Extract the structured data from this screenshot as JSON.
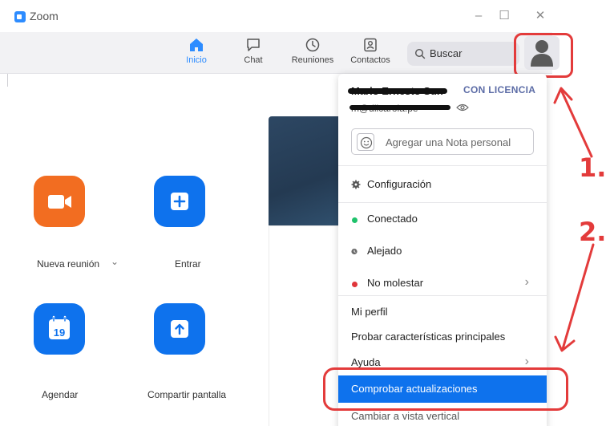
{
  "app": {
    "title": "Zoom"
  },
  "nav": {
    "tabs": [
      {
        "label": "Inicio",
        "icon": "home-icon",
        "active": true
      },
      {
        "label": "Chat",
        "icon": "chat-bubble-icon",
        "active": false
      },
      {
        "label": "Reuniones",
        "icon": "clock-icon",
        "active": false
      },
      {
        "label": "Contactos",
        "icon": "contact-card-icon",
        "active": false
      }
    ],
    "search_label": "Buscar"
  },
  "home": {
    "new_meeting_label": "Nueva reunión",
    "new_meeting_chevron": "⌄",
    "join_label": "Entrar",
    "schedule_label": "Agendar",
    "schedule_day": "19",
    "share_screen_label": "Compartir pantalla"
  },
  "profile_menu": {
    "user_name": "Mario Ernesto Sun",
    "license_badge": "CON LICENCIA",
    "email": "m@dlicarola.pe",
    "note_placeholder": "Agregar una Nota personal",
    "settings_label": "Configuración",
    "status": {
      "connected_label": "Conectado",
      "away_label": "Alejado",
      "dnd_label": "No molestar"
    },
    "profile_label": "Mi perfil",
    "try_features_label": "Probar características principales",
    "help_label": "Ayuda",
    "check_updates_label": "Comprobar actualizaciones",
    "vertical_view_label": "Cambiar a vista vertical"
  },
  "annotations": {
    "step1": "1.",
    "step2": "2."
  },
  "colors": {
    "zoom_blue": "#0e72ed",
    "accent_blue": "#2d8cff",
    "orange": "#f26d21",
    "annotation_red": "#e33b3b",
    "status_green": "#1fc26b",
    "status_gray": "#6b6b6b",
    "status_red": "#e0363b"
  }
}
